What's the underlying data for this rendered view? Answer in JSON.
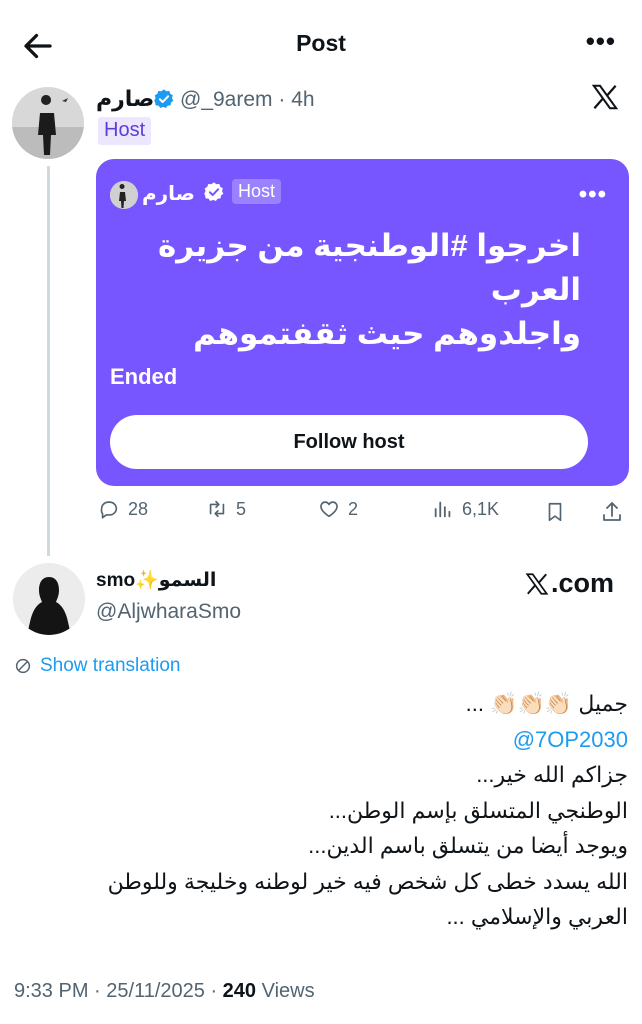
{
  "header": {
    "title": "Post"
  },
  "post1": {
    "name": "صارم",
    "handle": "@_9arem",
    "time": "4h",
    "host_label": "Host",
    "space": {
      "host_name": "صارم",
      "host_label": "Host",
      "title_line1": "اخرجوا #الوطنجية من جزيرة العرب",
      "title_line2": "واجلدوهم حيث ثقفتموهم",
      "status": "Ended",
      "follow_button": "Follow host"
    },
    "stats": {
      "replies": "28",
      "reposts": "5",
      "likes": "2",
      "views": "6,1K"
    }
  },
  "post2": {
    "name": "smo✨السمو",
    "handle": "@AljwharaSmo",
    "source": ".com",
    "show_translation": "Show translation",
    "text_line1": "جميل 👏🏻👏🏻👏🏻 ...",
    "mention": "@7OP2030",
    "text_line3": "جزاكم الله خير...",
    "text_line4": "الوطنجي المتسلق بإسم الوطن...",
    "text_line5": "ويوجد أيضا من يتسلق باسم الدين...",
    "text_line6": "الله يسدد خطى كل شخص فيه خير لوطنه وخليجة وللوطن",
    "text_line7": "العربي والإسلامي ...",
    "time": "9:33 PM",
    "date": "25/11/2025",
    "views_count": "240",
    "views_label": "Views"
  },
  "colors": {
    "space_purple": "#7856ff",
    "link_blue": "#1d9bf0",
    "verified_blue": "#1d9bf0"
  }
}
